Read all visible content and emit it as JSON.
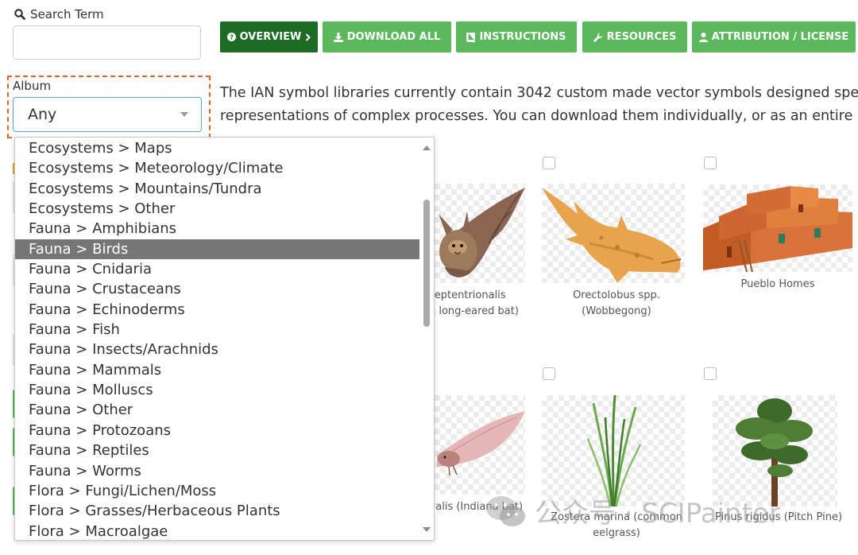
{
  "search": {
    "label": "Search Term",
    "value": "",
    "placeholder": ""
  },
  "album": {
    "label": "Album",
    "selected": "Any",
    "options": [
      "Ecosystems > Maps",
      "Ecosystems > Meteorology/Climate",
      "Ecosystems > Mountains/Tundra",
      "Ecosystems > Other",
      "Fauna > Amphibians",
      "Fauna > Birds",
      "Fauna > Cnidaria",
      "Fauna > Crustaceans",
      "Fauna > Echinoderms",
      "Fauna > Fish",
      "Fauna > Insects/Arachnids",
      "Fauna > Mammals",
      "Fauna > Molluscs",
      "Fauna > Other",
      "Fauna > Protozoans",
      "Fauna > Reptiles",
      "Fauna > Worms",
      "Flora > Fungi/Lichen/Moss",
      "Flora > Grasses/Herbaceous Plants",
      "Flora > Macroalgae"
    ],
    "highlighted": "Fauna > Birds"
  },
  "nav": {
    "overview": "OVERVIEW",
    "download_all": "DOWNLOAD ALL",
    "instructions": "INSTRUCTIONS",
    "resources": "RESOURCES",
    "attribution": "ATTRIBUTION / LICENSE"
  },
  "intro": {
    "line1": "The IAN symbol libraries currently contain 3042 custom made vector symbols designed specifically",
    "line2": "representations of complex processes. You can download them individually, or as an entire packag"
  },
  "gallery": {
    "row1": [
      {
        "caption1": "septentrionalis",
        "caption2": "n long-eared bat)"
      },
      {
        "caption1": "Orectolobus spp.",
        "caption2": "(Wobbegong)"
      },
      {
        "caption1": "Pueblo Homes",
        "caption2": ""
      }
    ],
    "row2": [
      {
        "caption1": "dalis (Indiana bat)",
        "caption2": ""
      },
      {
        "caption1": "Zostera marina (common",
        "caption2": "eelgrass)"
      },
      {
        "caption1": "Pinus rigidus (Pitch Pine)",
        "caption2": ""
      }
    ]
  },
  "watermark": {
    "text": "公众号 · SCIPainter"
  },
  "colors": {
    "button_green": "#5cb85c",
    "button_active": "#1e6b25",
    "highlight_border": "#e0652a",
    "selected_option": "#767676"
  }
}
